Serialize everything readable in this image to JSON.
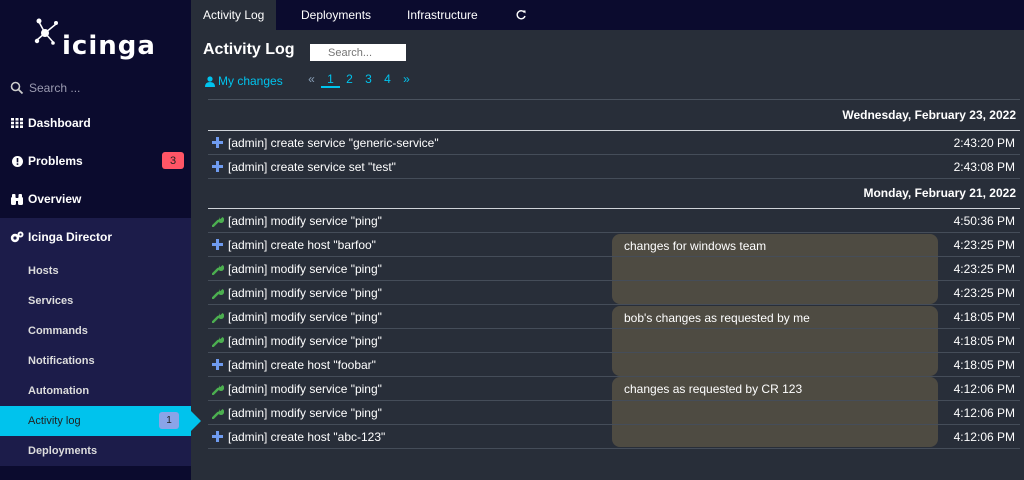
{
  "app": {
    "logo_text": "icinga"
  },
  "sidebar": {
    "search_placeholder": "Search ...",
    "items": [
      {
        "label": "Dashboard",
        "icon": "grid-icon"
      },
      {
        "label": "Problems",
        "icon": "alert-circle-icon",
        "badge": "3"
      },
      {
        "label": "Overview",
        "icon": "binoculars-icon"
      },
      {
        "label": "Icinga Director",
        "icon": "cogs-icon"
      }
    ],
    "sub_items": [
      {
        "label": "Hosts"
      },
      {
        "label": "Services"
      },
      {
        "label": "Commands"
      },
      {
        "label": "Notifications"
      },
      {
        "label": "Automation"
      },
      {
        "label": "Activity log",
        "badge": "1",
        "active": true
      },
      {
        "label": "Deployments"
      }
    ]
  },
  "tabs": [
    {
      "label": "Activity Log",
      "active": true
    },
    {
      "label": "Deployments"
    },
    {
      "label": "Infrastructure"
    }
  ],
  "main": {
    "title": "Activity Log",
    "search_placeholder": "Search...",
    "my_changes": "My changes",
    "pager": {
      "prev": "«",
      "pages": [
        "1",
        "2",
        "3",
        "4"
      ],
      "next": "»",
      "current": "1"
    }
  },
  "groups": [
    {
      "date": "Wednesday, February 23, 2022",
      "rows": [
        {
          "icon": "plus-icon",
          "text": "[admin] create service \"generic-service\"",
          "time": "2:43:20 PM"
        },
        {
          "icon": "plus-icon",
          "text": "[admin] create service set \"test\"",
          "time": "2:43:08 PM"
        }
      ]
    },
    {
      "date": "Monday, February 21, 2022",
      "rows": [
        {
          "icon": "wrench-icon",
          "text": "[admin] modify service \"ping\"",
          "time": "4:50:36 PM"
        },
        {
          "icon": "plus-icon",
          "text": "[admin] create host \"barfoo\"",
          "time": "4:23:25 PM"
        },
        {
          "icon": "wrench-icon",
          "text": "[admin] modify service \"ping\"",
          "time": "4:23:25 PM"
        },
        {
          "icon": "wrench-icon",
          "text": "[admin] modify service \"ping\"",
          "time": "4:23:25 PM"
        },
        {
          "icon": "wrench-icon",
          "text": "[admin] modify service \"ping\"",
          "time": "4:18:05 PM"
        },
        {
          "icon": "wrench-icon",
          "text": "[admin] modify service \"ping\"",
          "time": "4:18:05 PM"
        },
        {
          "icon": "plus-icon",
          "text": "[admin] create host \"foobar\"",
          "time": "4:18:05 PM"
        },
        {
          "icon": "wrench-icon",
          "text": "[admin] modify service \"ping\"",
          "time": "4:12:06 PM"
        },
        {
          "icon": "wrench-icon",
          "text": "[admin] modify service \"ping\"",
          "time": "4:12:06 PM"
        },
        {
          "icon": "plus-icon",
          "text": "[admin] create host \"abc-123\"",
          "time": "4:12:06 PM"
        }
      ]
    }
  ],
  "notes": [
    {
      "text": "changes for windows team"
    },
    {
      "text": "bob's changes as requested by me"
    },
    {
      "text": "changes as requested by CR 123"
    }
  ],
  "colors": {
    "accent": "#00c3ed",
    "problem_badge": "#ff5566",
    "plus_icon": "#6f9bf0",
    "wrench_icon": "#4caf50",
    "note_bg": "#4e4b42"
  }
}
